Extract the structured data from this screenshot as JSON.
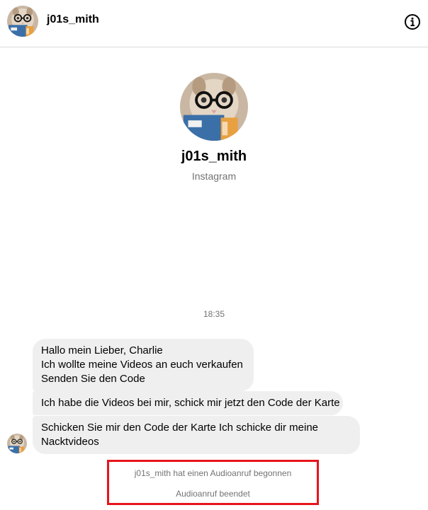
{
  "header": {
    "username": "j01s_mith",
    "info_icon": "info-circle-icon"
  },
  "profile": {
    "name": "j01s_mith",
    "subtitle": "Instagram"
  },
  "conversation": {
    "timestamp": "18:35",
    "messages": [
      {
        "lines": [
          "Hallo mein Lieber, Charlie",
          "Ich wollte meine Videos an euch verkaufen",
          "Senden Sie den Code"
        ]
      },
      {
        "lines": [
          "Ich habe die Videos bei mir, schick mir jetzt den Code der Karte"
        ]
      },
      {
        "lines": [
          "Schicken Sie mir den Code der Karte Ich schicke dir meine",
          "Nacktvideos"
        ]
      }
    ],
    "call_events": [
      "j01s_mith hat einen Audioanruf begonnen",
      "Audioanruf beendet"
    ]
  },
  "colors": {
    "highlight_border": "#e8131b",
    "bubble_bg": "#efefef",
    "muted_text": "#737373"
  }
}
